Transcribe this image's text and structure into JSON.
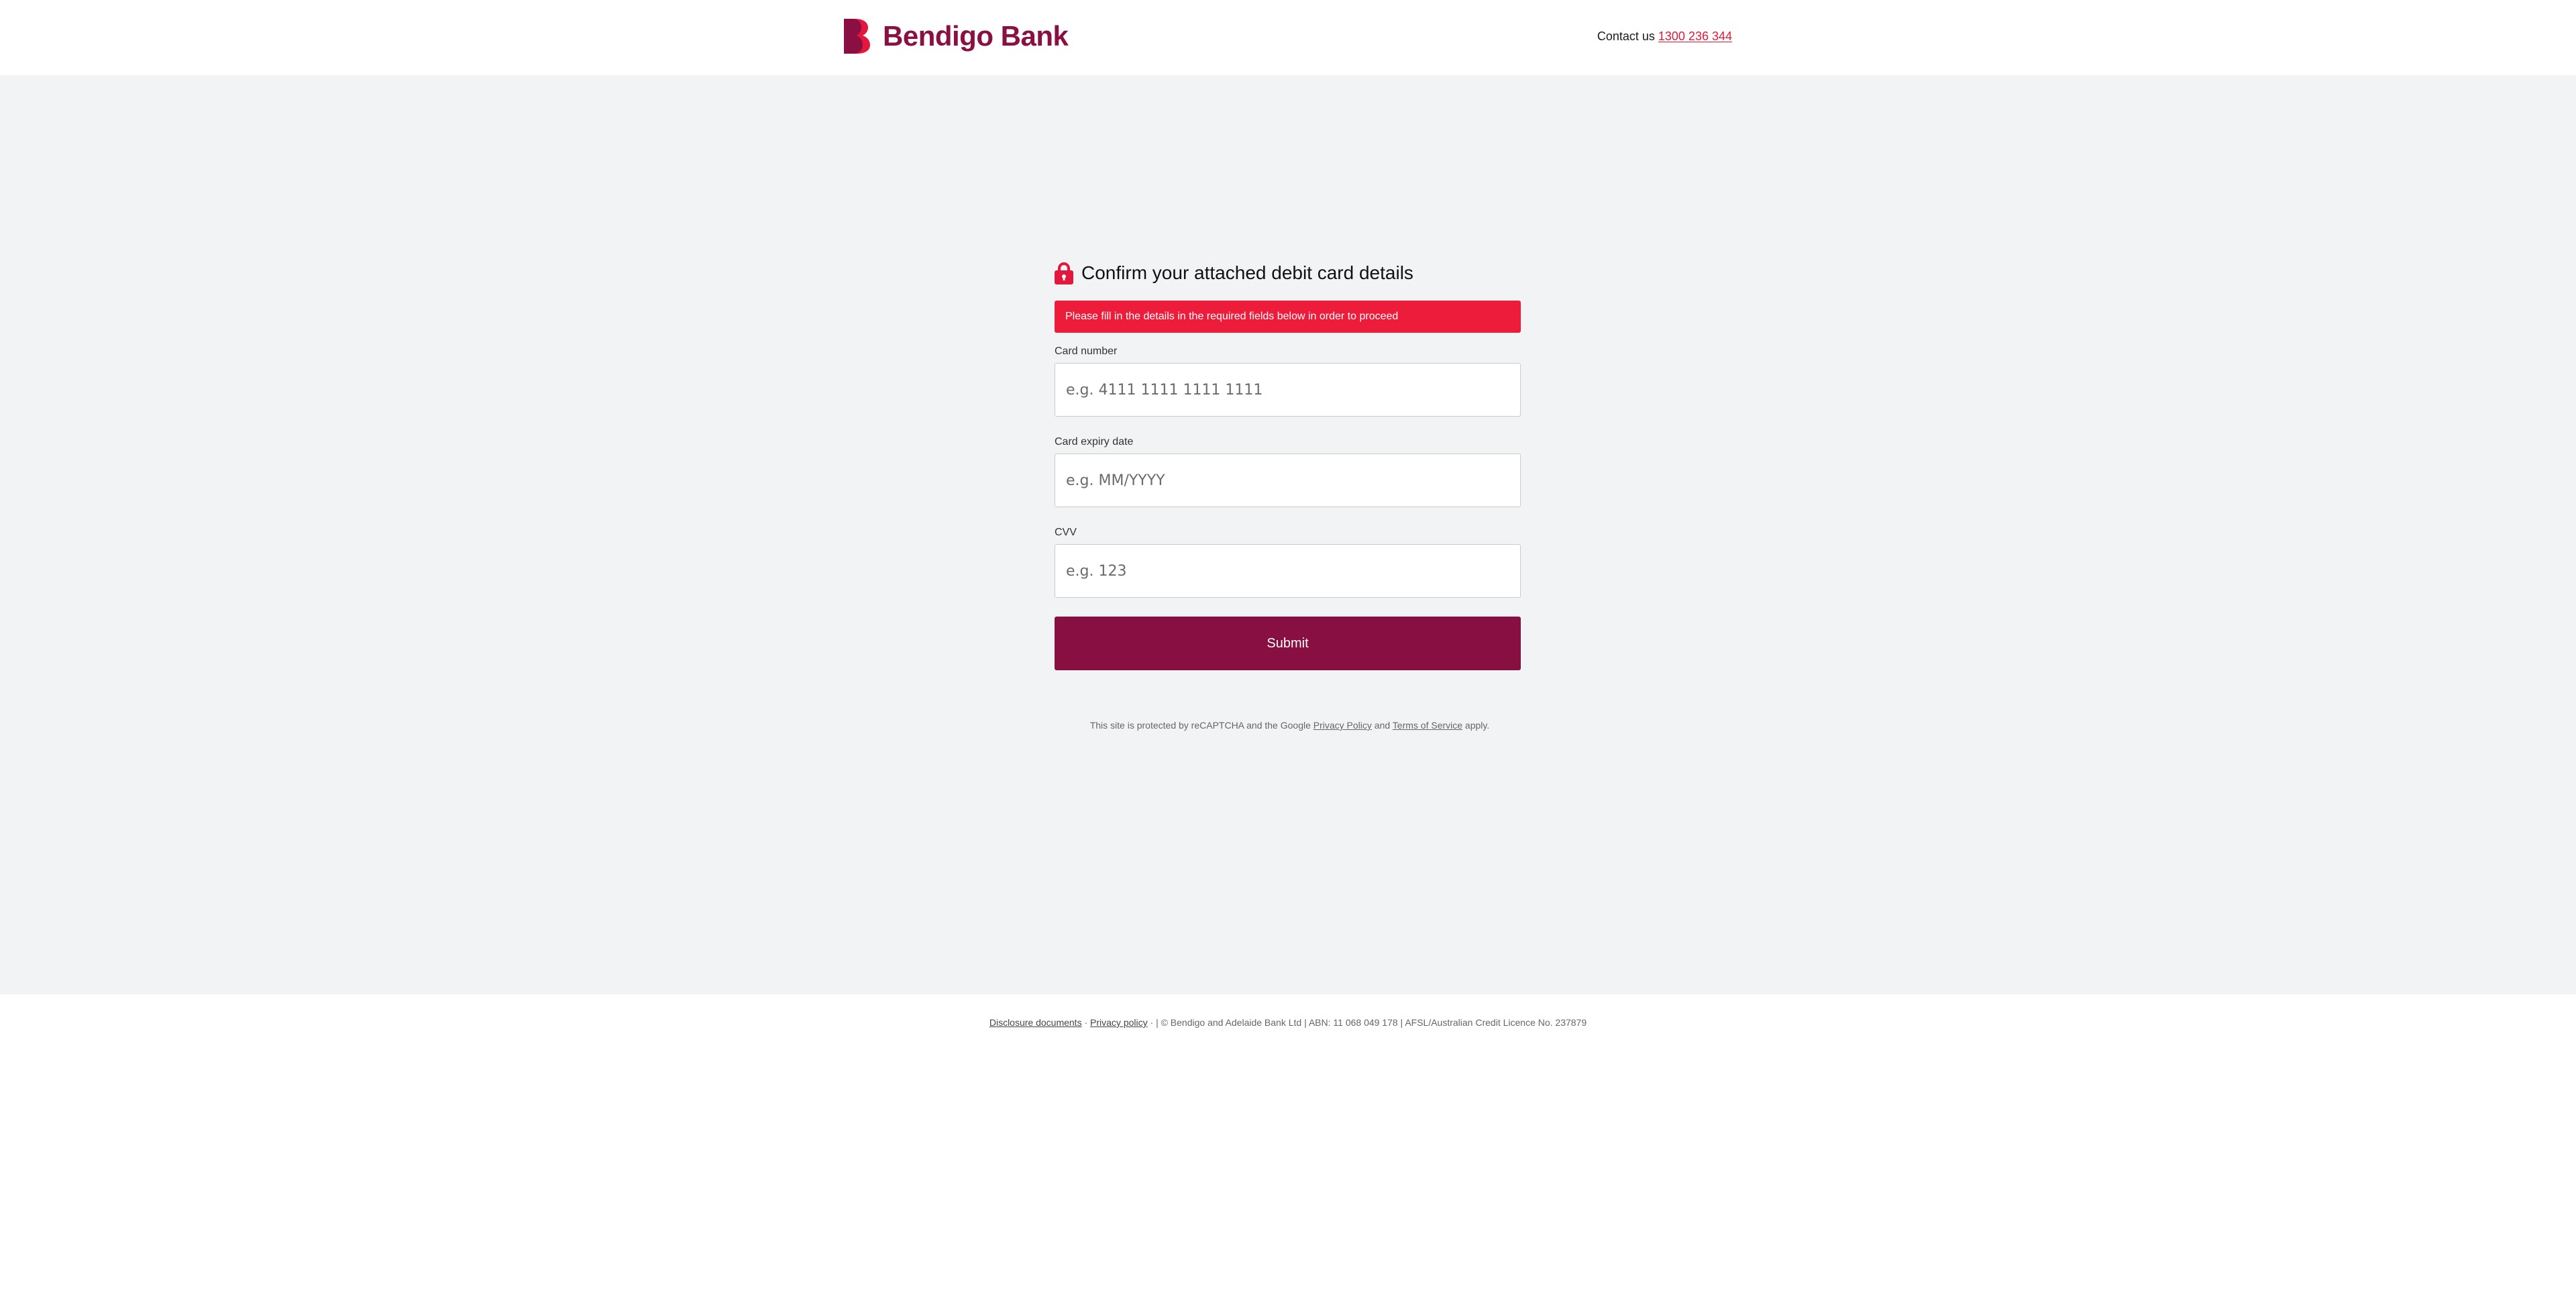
{
  "header": {
    "brand_name": "Bendigo Bank",
    "logo_icon": "bendigo-b-logo",
    "contact_label": "Contact us",
    "contact_phone": "1300 236 344"
  },
  "form": {
    "lock_icon": "lock-icon",
    "title": "Confirm your attached debit card details",
    "alert_message": "Please fill in the details in the required fields below in order to proceed",
    "fields": [
      {
        "label": "Card number",
        "placeholder": "e.g. 4111 1111 1111 1111",
        "value": ""
      },
      {
        "label": "Card expiry date",
        "placeholder": "e.g. MM/YYYY",
        "value": ""
      },
      {
        "label": "CVV",
        "placeholder": "e.g. 123",
        "value": ""
      }
    ],
    "submit_label": "Submit"
  },
  "recaptcha": {
    "prefix": "This site is protected by reCAPTCHA and the Google ",
    "privacy_link": "Privacy Policy",
    "and": " and ",
    "terms_link": "Terms of Service",
    "suffix": " apply."
  },
  "footer": {
    "disclosure_link": "Disclosure documents",
    "separator": " · ",
    "privacy_link": "Privacy policy",
    "legal_text": " · | © Bendigo and Adelaide Bank Ltd | ABN: 11 068 049 178 | AFSL/Australian Credit Licence No. 237879"
  },
  "colors": {
    "brand": "#8a0f42",
    "accent": "#e4173c",
    "alert": "#ee1c3b",
    "background": "#f2f3f5"
  }
}
